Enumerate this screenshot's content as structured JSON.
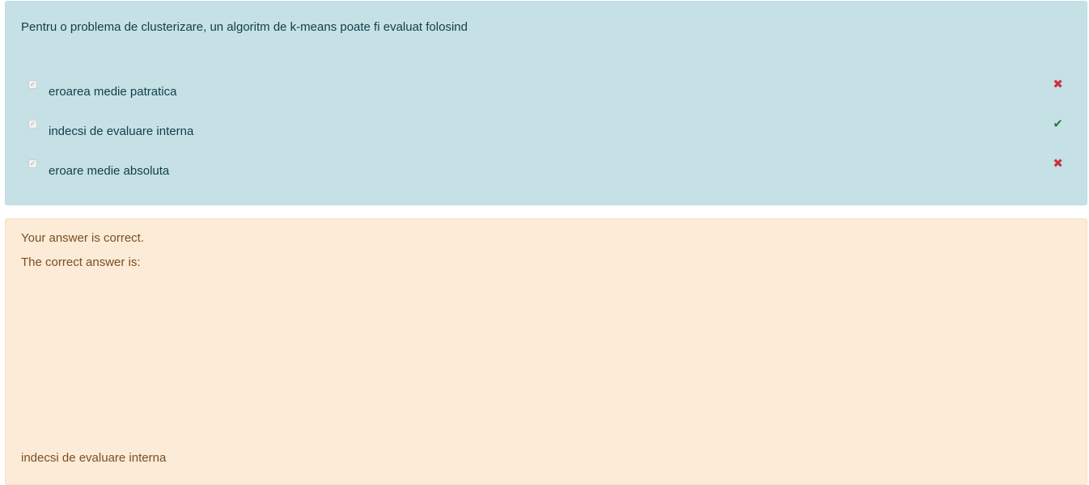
{
  "question": {
    "text": "Pentru o problema de clusterizare, un algoritm de k-means poate fi evaluat folosind",
    "options": [
      {
        "label": "eroarea medie patratica",
        "checked": true,
        "result": "incorrect",
        "result_icon": "cross-icon",
        "result_glyph": "✖"
      },
      {
        "label": "indecsi de evaluare interna",
        "checked": true,
        "result": "correct",
        "result_icon": "check-icon",
        "result_glyph": "✔"
      },
      {
        "label": "eroare medie absoluta",
        "checked": true,
        "result": "incorrect",
        "result_icon": "cross-icon",
        "result_glyph": "✖"
      }
    ],
    "checkbox_glyph": "✓"
  },
  "feedback": {
    "status": "Your answer is correct.",
    "correct_intro": "The correct answer is:",
    "correct_answer": "indecsi de evaluare interna"
  },
  "colors": {
    "question_bg": "#c6e1e6",
    "feedback_bg": "#fbebd7",
    "incorrect": "#c9343f",
    "correct": "#2a7a36"
  }
}
